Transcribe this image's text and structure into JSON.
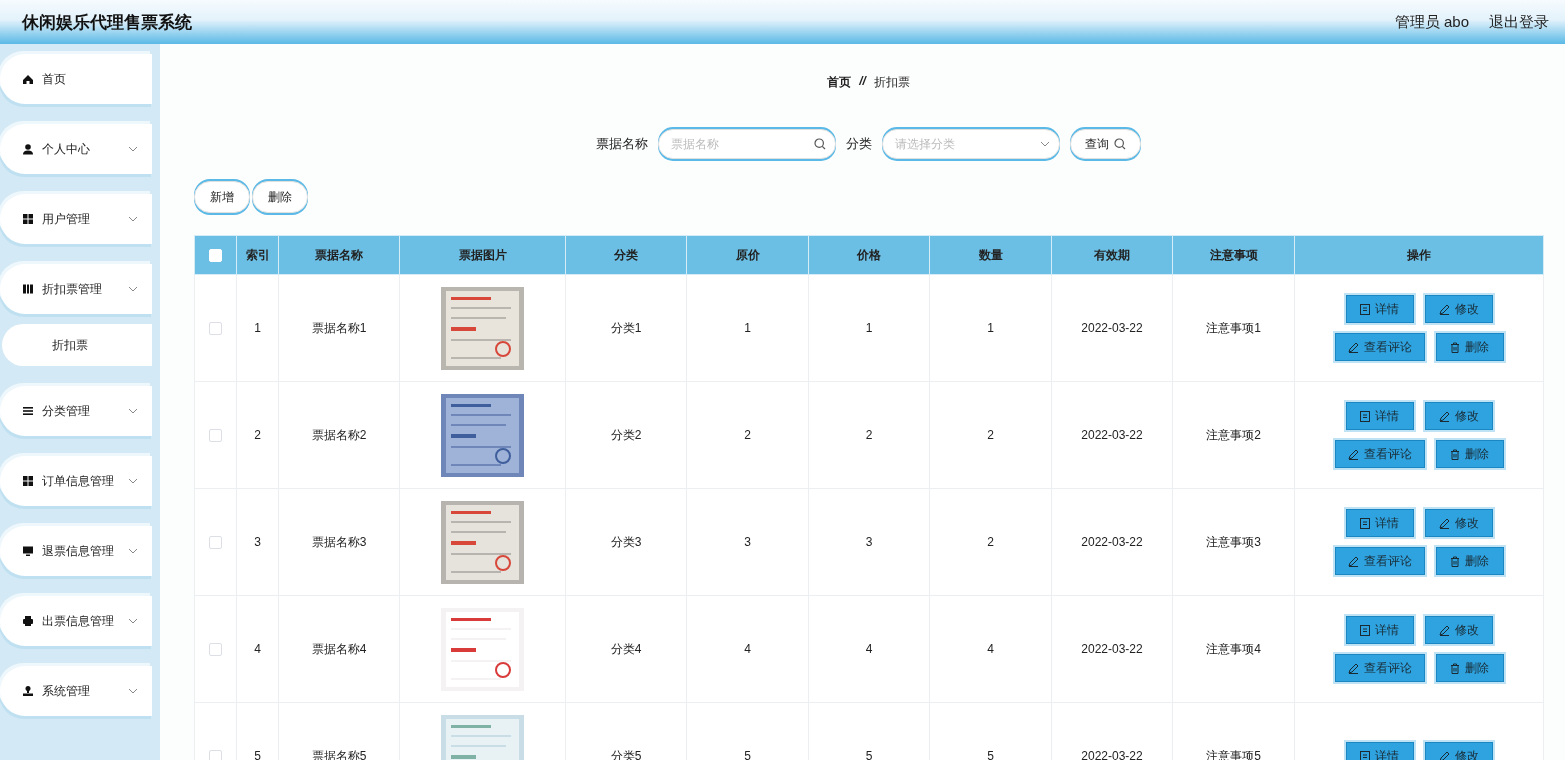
{
  "header": {
    "title": "休闲娱乐代理售票系统",
    "user": "管理员 abo",
    "logout": "退出登录"
  },
  "sidebar": {
    "items": [
      {
        "label": "首页",
        "kind": "link"
      },
      {
        "label": "个人中心",
        "kind": "menu"
      },
      {
        "label": "用户管理",
        "kind": "menu"
      },
      {
        "label": "折扣票管理",
        "kind": "menu",
        "children": [
          {
            "label": "折扣票"
          }
        ]
      },
      {
        "label": "分类管理",
        "kind": "menu"
      },
      {
        "label": "订单信息管理",
        "kind": "menu"
      },
      {
        "label": "退票信息管理",
        "kind": "menu"
      },
      {
        "label": "出票信息管理",
        "kind": "menu"
      },
      {
        "label": "系统管理",
        "kind": "menu"
      }
    ]
  },
  "breadcrumb": {
    "home": "首页",
    "separator": "//",
    "current": "折扣票"
  },
  "search": {
    "name_label": "票据名称",
    "name_placeholder": "票据名称",
    "category_label": "分类",
    "category_placeholder": "请选择分类",
    "query_button": "查询"
  },
  "toolbar": [
    "新增",
    "删除"
  ],
  "table": {
    "select_all_checked": false,
    "columns": [
      "索引",
      "票据名称",
      "票据图片",
      "分类",
      "原价",
      "价格",
      "数量",
      "有效期",
      "注意事项",
      "操作"
    ],
    "rows": [
      {
        "checked": false,
        "index": "1",
        "name": "票据名称1",
        "category": "分类1",
        "original_price": "1",
        "price": "1",
        "quantity": "1",
        "valid_until": "2022-03-22",
        "notes": "注意事项1",
        "actions": [
          "详情",
          "修改",
          "查看评论",
          "删除"
        ]
      },
      {
        "checked": false,
        "index": "2",
        "name": "票据名称2",
        "category": "分类2",
        "original_price": "2",
        "price": "2",
        "quantity": "2",
        "valid_until": "2022-03-22",
        "notes": "注意事项2",
        "actions": [
          "详情",
          "修改",
          "查看评论",
          "删除"
        ]
      },
      {
        "checked": false,
        "index": "3",
        "name": "票据名称3",
        "category": "分类3",
        "original_price": "3",
        "price": "3",
        "quantity": "2",
        "valid_until": "2022-03-22",
        "notes": "注意事项3",
        "actions": [
          "详情",
          "修改",
          "查看评论",
          "删除"
        ]
      },
      {
        "checked": false,
        "index": "4",
        "name": "票据名称4",
        "category": "分类4",
        "original_price": "4",
        "price": "4",
        "quantity": "4",
        "valid_until": "2022-03-22",
        "notes": "注意事项4",
        "actions": [
          "详情",
          "修改",
          "查看评论",
          "删除"
        ]
      },
      {
        "checked": false,
        "index": "5",
        "name": "票据名称5",
        "category": "分类5",
        "original_price": "5",
        "price": "5",
        "quantity": "5",
        "valid_until": "2022-03-22",
        "notes": "注意事项5",
        "actions": [
          "详情",
          "修改"
        ]
      }
    ]
  }
}
